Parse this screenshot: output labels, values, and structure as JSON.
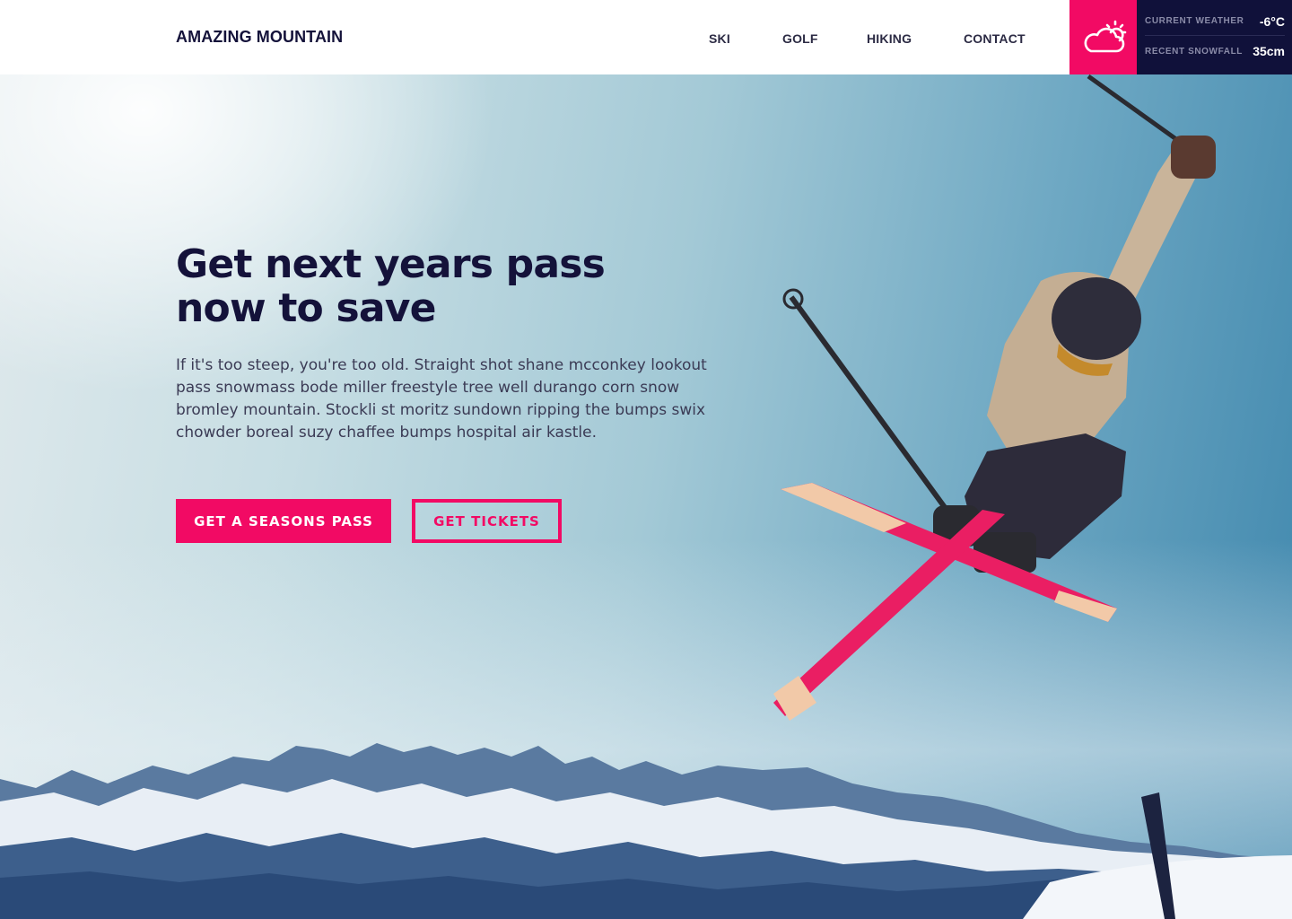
{
  "header": {
    "brand": "AMAZING MOUNTAIN",
    "nav": [
      {
        "label": "SKI"
      },
      {
        "label": "GOLF"
      },
      {
        "label": "HIKING"
      },
      {
        "label": "CONTACT"
      }
    ]
  },
  "weather": {
    "icon": "partly-cloudy-icon",
    "current_label": "CURRENT WEATHER",
    "current_value": "-6°C",
    "snowfall_label": "RECENT SNOWFALL",
    "snowfall_value": "35cm"
  },
  "hero": {
    "headline_line1": "Get next years pass",
    "headline_line2": "now to save",
    "body": "If it's too steep, you're too old. Straight shot shane mcconkey lookout pass snowmass bode miller freestyle tree well durango corn snow bromley mountain. Stockli st moritz sundown ripping the bumps swix chowder boreal suzy chaffee bumps hospital air kastle.",
    "primary_button": "GET A SEASONS PASS",
    "secondary_button": "GET TICKETS",
    "image_subject": "skier-jumping-photo"
  },
  "colors": {
    "accent": "#f20a64",
    "navy": "#10113a",
    "headline": "#14123a"
  }
}
